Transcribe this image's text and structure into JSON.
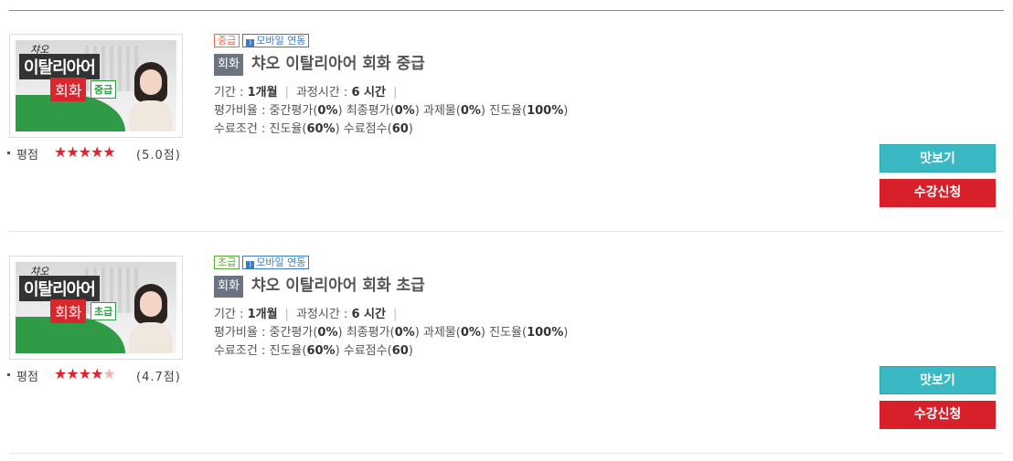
{
  "courses": [
    {
      "thumb": {
        "chao": "챠오",
        "title": "이탈리아어",
        "conv": "회화",
        "level": "중급"
      },
      "rating_label": "평점",
      "stars": "★★★★★",
      "stars_empty": "",
      "score": "(5.0점)",
      "level_badge": "중급",
      "mobile_badge": "모바일 연동",
      "category": "회화",
      "title": "챠오 이탈리아어 회화 중급",
      "period_label": "기간 : ",
      "period_value": "1개월",
      "hours_label": "과정시간 : ",
      "hours_value": "6 시간",
      "eval_label": "평가비율 : 중간평가(",
      "eval_mid": "0%",
      "eval_final_label": ") 최종평가(",
      "eval_final": "0%",
      "eval_task_label": ") 과제물(",
      "eval_task": "0%",
      "eval_progress_label": ") 진도율(",
      "eval_progress": "100%",
      "eval_end": ")",
      "cond_label": "수료조건 : 진도율(",
      "cond_progress": "60%",
      "cond_score_label": ") 수료점수(",
      "cond_score": "60",
      "cond_end": ")",
      "preview_label": "맛보기",
      "enroll_label": "수강신청"
    },
    {
      "thumb": {
        "chao": "챠오",
        "title": "이탈리아어",
        "conv": "회화",
        "level": "초급"
      },
      "rating_label": "평점",
      "stars": "★★★★",
      "stars_empty": "★",
      "score": "(4.7점)",
      "level_badge": "초급",
      "mobile_badge": "모바일 연동",
      "category": "회화",
      "title": "챠오 이탈리아어 회화 초급",
      "period_label": "기간 : ",
      "period_value": "1개월",
      "hours_label": "과정시간 : ",
      "hours_value": "6 시간",
      "eval_label": "평가비율 : 중간평가(",
      "eval_mid": "0%",
      "eval_final_label": ") 최종평가(",
      "eval_final": "0%",
      "eval_task_label": ") 과제물(",
      "eval_task": "0%",
      "eval_progress_label": ") 진도율(",
      "eval_progress": "100%",
      "eval_end": ")",
      "cond_label": "수료조건 : 진도율(",
      "cond_progress": "60%",
      "cond_score_label": ") 수료점수(",
      "cond_score": "60",
      "cond_end": ")",
      "preview_label": "맛보기",
      "enroll_label": "수강신청"
    }
  ],
  "colors": {
    "accent_teal": "#3ab9c4",
    "accent_red": "#d7202a",
    "star_red": "#e0242f",
    "badge_mid": "#e5694e",
    "badge_beg": "#5aa736",
    "badge_mobile": "#3a7bc8"
  }
}
